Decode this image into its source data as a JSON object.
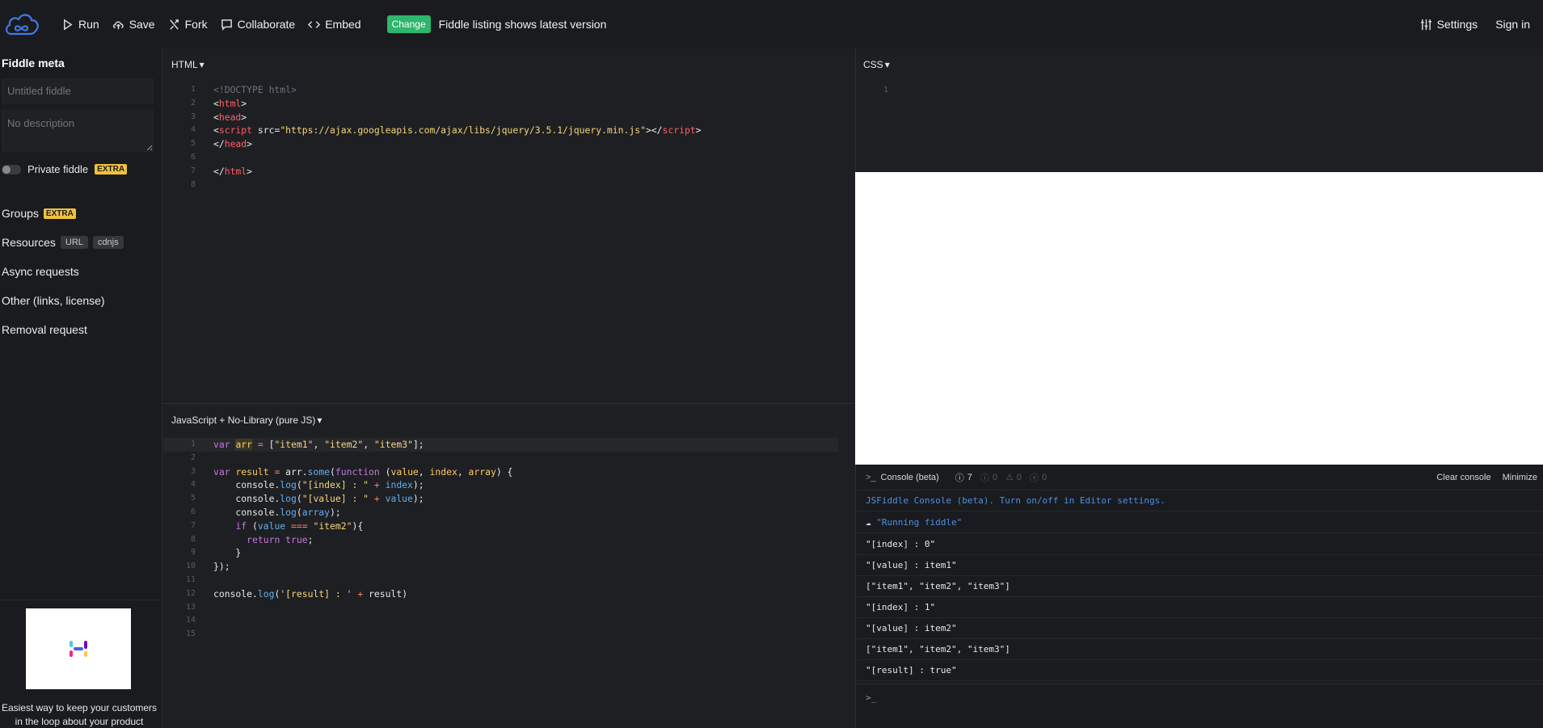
{
  "topbar": {
    "run": "Run",
    "save": "Save",
    "fork": "Fork",
    "collaborate": "Collaborate",
    "embed": "Embed",
    "change_badge": "Change",
    "change_text": "Fiddle listing shows latest version",
    "settings": "Settings",
    "sign_in": "Sign in"
  },
  "sidebar": {
    "title": "Fiddle meta",
    "name_placeholder": "Untitled fiddle",
    "desc_placeholder": "No description",
    "private_label": "Private fiddle",
    "extra_badge": "EXTRA",
    "groups": "Groups",
    "resources": "Resources",
    "url_tag": "URL",
    "cdnjs_tag": "cdnjs",
    "async": "Async requests",
    "other": "Other (links, license)",
    "removal": "Removal request",
    "ad_text": "Easiest way to keep your customers in the loop about your product"
  },
  "html_panel": {
    "label": "HTML",
    "line_numbers": [
      "1",
      "2",
      "3",
      "4",
      "5",
      "6",
      "7",
      "8"
    ]
  },
  "js_panel": {
    "label": "JavaScript + No-Library (pure JS)",
    "line_numbers": [
      "1",
      "2",
      "3",
      "4",
      "5",
      "6",
      "7",
      "8",
      "9",
      "10",
      "11",
      "12",
      "13",
      "14",
      "15"
    ]
  },
  "css_panel": {
    "label": "CSS",
    "line_numbers": [
      "1"
    ]
  },
  "console": {
    "title": "Console (beta)",
    "log_count": "7",
    "info_count": "0",
    "warn_count": "0",
    "error_count": "0",
    "clear": "Clear console",
    "minimize": "Minimize",
    "info_line": "JSFiddle Console (beta). Turn on/off in Editor settings.",
    "running": "\"Running fiddle\"",
    "logs": [
      "\"[index] : 0\"",
      "\"[value] : item1\"",
      "[\"item1\", \"item2\", \"item3\"]",
      "\"[index] : 1\"",
      "\"[value] : item2\"",
      "[\"item1\", \"item2\", \"item3\"]",
      "\"[result] : true\""
    ],
    "prompt": ">_"
  },
  "colors": {
    "accent_green": "#2eb66c",
    "extra_yellow": "#f0c040",
    "console_blue": "#4d8fe8",
    "bg_dark": "#1e1f22"
  }
}
